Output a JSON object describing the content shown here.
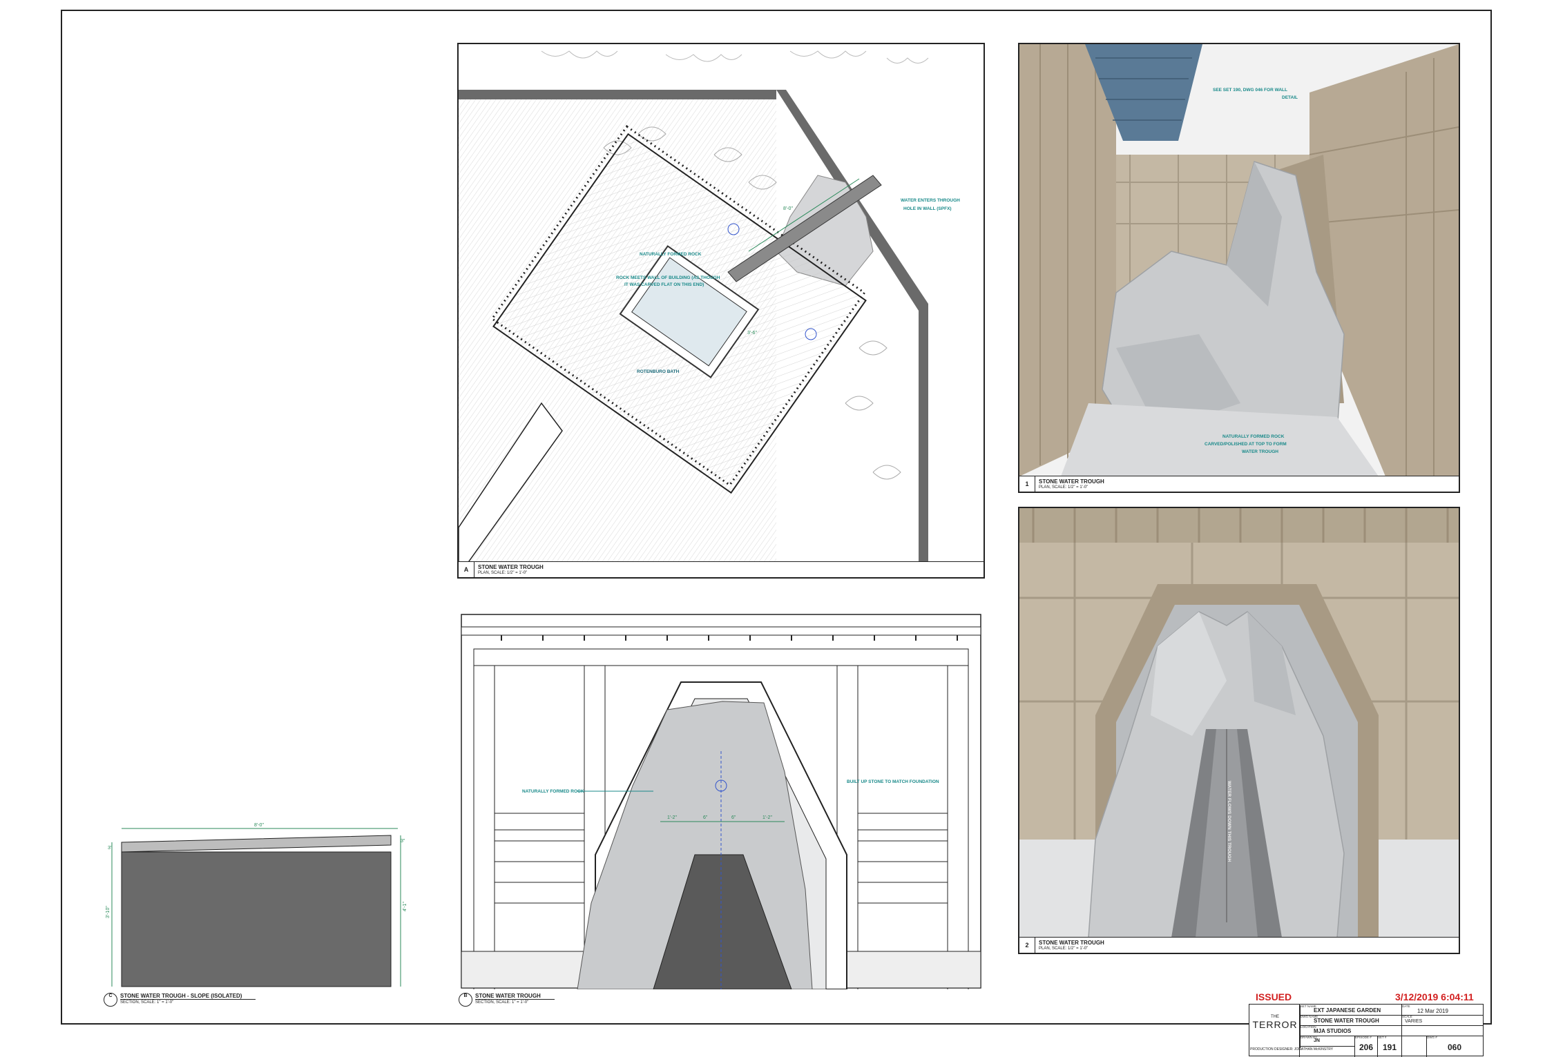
{
  "sheet": {
    "status": "ISSUED",
    "timestamp": "3/12/2019 6:04:11"
  },
  "panels": {
    "plan": {
      "number": "A",
      "title": "STONE WATER TROUGH",
      "scale": "PLAN, SCALE: 1/2\" = 1'-0\"",
      "labels": {
        "water_enters": "WATER ENTERS THROUGH",
        "water_enters2": "HOLE IN WALL (SPFX)",
        "naturally_formed": "NATURALLY FORMED ROCK",
        "rock_meets": "ROCK MEETS WALL OF BUILDING (AS THOUGH",
        "rock_meets2": "IT WAS CARVED FLAT ON THIS END)",
        "bath": "ROTENBURO BATH",
        "dim_len": "8'-0\"",
        "dim_w": "3'-6\""
      }
    },
    "view1": {
      "number": "1",
      "title": "STONE WATER TROUGH",
      "scale": "PLAN, SCALE: 1/2\" = 1'-0\"",
      "labels": {
        "see_set": "SEE SET 190, DWG 046 FOR WALL",
        "see_set2": "DETAIL",
        "rock1": "NATURALLY FORMED ROCK",
        "rock2": "CARVED/POLISHED AT TOP TO FORM",
        "rock3": "WATER TROUGH"
      }
    },
    "view2": {
      "number": "2",
      "title": "STONE WATER TROUGH",
      "scale": "PLAN, SCALE: 1/2\" = 1'-0\"",
      "label_flow": "WATER FLOWS DOWN THIS TROUGH"
    },
    "elevation": {
      "number": "B",
      "title": "STONE WATER TROUGH",
      "scale": "SECTION, SCALE: 1\" = 1'-0\"",
      "labels": {
        "naturally_formed": "NATURALLY FORMED ROCK",
        "built_up": "BUILT UP STONE TO MATCH FOUNDATION",
        "d1": "1'-2\"",
        "d2": "6\"",
        "d3": "6\"",
        "d4": "1'-2\""
      }
    },
    "section": {
      "number": "C",
      "title": "STONE WATER TROUGH - SLOPE (ISOLATED)",
      "scale": "SECTION, SCALE: 1\" = 1'-0\"",
      "labels": {
        "width": "8'-0\"",
        "left_h": "3'-10\"",
        "right_h": "4'-1\"",
        "top_l": "3\"",
        "top_r": "3\""
      }
    }
  },
  "title_block": {
    "show_logo_the": "THE",
    "show_logo_name": "TERROR",
    "designer": "PRODUCTION DESIGNER: JONATHAN McKINSTRY",
    "set_name": "EXT JAPANESE GARDEN",
    "date": "12 Mar 2019",
    "drawing_name": "STONE WATER TROUGH",
    "scale": "VARIES",
    "location": "MJA STUDIOS",
    "drawn_by": "JN",
    "episode": "206",
    "set_no": "191",
    "dwg_no": "060",
    "field_set": "SET NAME",
    "field_dwg": "DWG NAME",
    "field_loc": "LOCATION",
    "field_by": "DRAWN BY",
    "field_date": "DATE",
    "field_scale": "SCALE",
    "field_ep": "EPISODE #",
    "field_setno": "SET #",
    "field_dwgno": "DWG #"
  },
  "colors": {
    "ink": "#222222",
    "annotation": "#1a8a8a",
    "dimension": "#2a8a5a",
    "issued_red": "#d21f1f",
    "wood": "#b7a994",
    "rock": "#c9cbcd",
    "panel_gray": "#6a6a6a"
  }
}
